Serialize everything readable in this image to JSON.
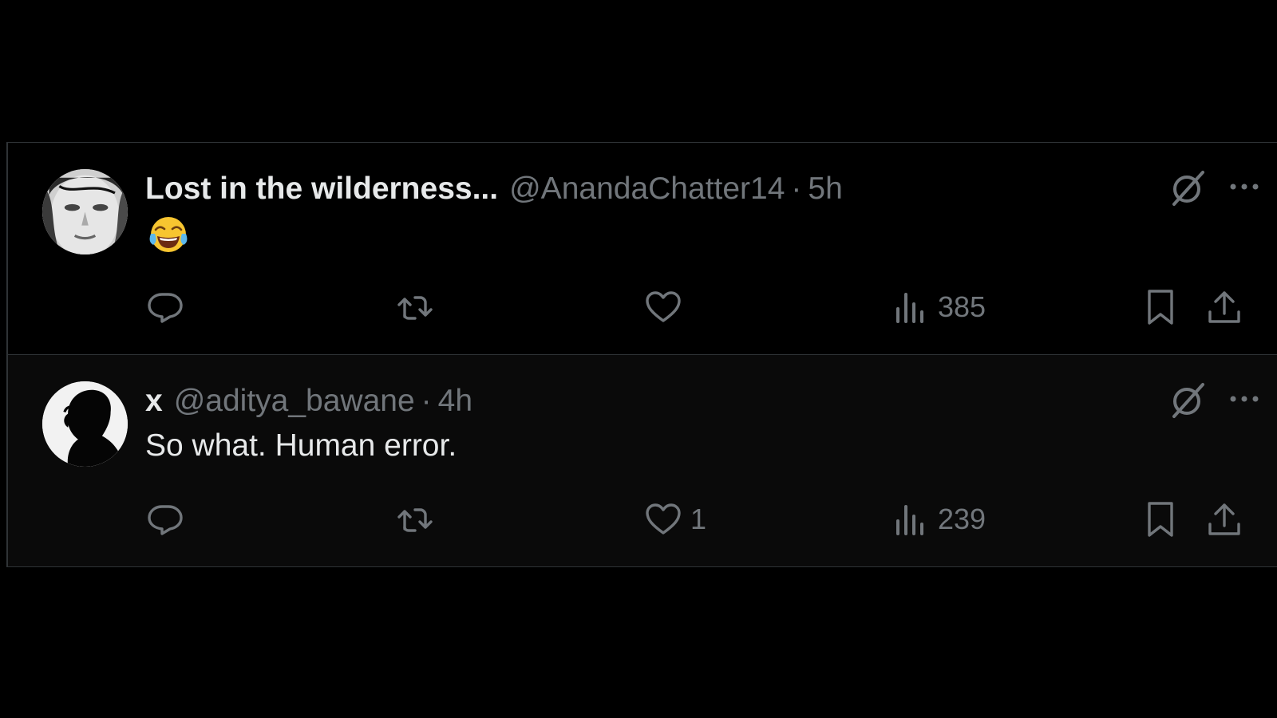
{
  "tweets": [
    {
      "display_name": "Lost in the wilderness...",
      "handle": "@AnandaChatter14",
      "separator": "·",
      "time": "5h",
      "text": "",
      "emoji": "face-with-tears-of-joy",
      "actions": {
        "reply_count": "",
        "retweet_count": "",
        "like_count": "",
        "views_count": "385"
      }
    },
    {
      "display_name": "x",
      "handle": "@aditya_bawane",
      "separator": "·",
      "time": "4h",
      "text": "So what. Human error.",
      "actions": {
        "reply_count": "",
        "retweet_count": "",
        "like_count": "1",
        "views_count": "239"
      }
    }
  ],
  "icons": {
    "reply": "reply-icon",
    "retweet": "retweet-icon",
    "like": "heart-icon",
    "views": "views-icon",
    "bookmark": "bookmark-icon",
    "share": "share-icon",
    "grok": "grok-icon",
    "more": "more-icon"
  },
  "colors": {
    "background": "#000000",
    "text_primary": "#e7e9ea",
    "text_secondary": "#71767b",
    "divider": "#2f3336"
  }
}
